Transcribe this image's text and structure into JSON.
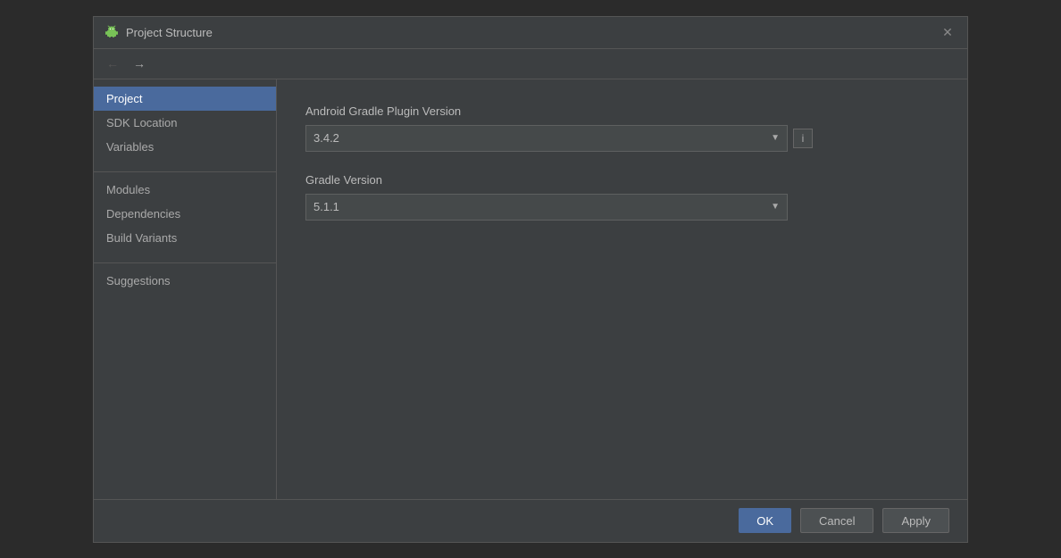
{
  "dialog": {
    "title": "Project Structure",
    "close_label": "✕"
  },
  "nav": {
    "back_label": "←",
    "forward_label": "→"
  },
  "sidebar": {
    "group1": [
      {
        "id": "project",
        "label": "Project",
        "active": true
      },
      {
        "id": "sdk-location",
        "label": "SDK Location",
        "active": false
      },
      {
        "id": "variables",
        "label": "Variables",
        "active": false
      }
    ],
    "group2": [
      {
        "id": "modules",
        "label": "Modules",
        "active": false
      },
      {
        "id": "dependencies",
        "label": "Dependencies",
        "active": false
      },
      {
        "id": "build-variants",
        "label": "Build Variants",
        "active": false
      }
    ],
    "group3": [
      {
        "id": "suggestions",
        "label": "Suggestions",
        "active": false
      }
    ]
  },
  "main": {
    "plugin_version_label": "Android Gradle Plugin Version",
    "plugin_version_value": "3.4.2",
    "gradle_version_label": "Gradle Version",
    "gradle_version_value": "5.1.1"
  },
  "footer": {
    "ok_label": "OK",
    "cancel_label": "Cancel",
    "apply_label": "Apply"
  }
}
